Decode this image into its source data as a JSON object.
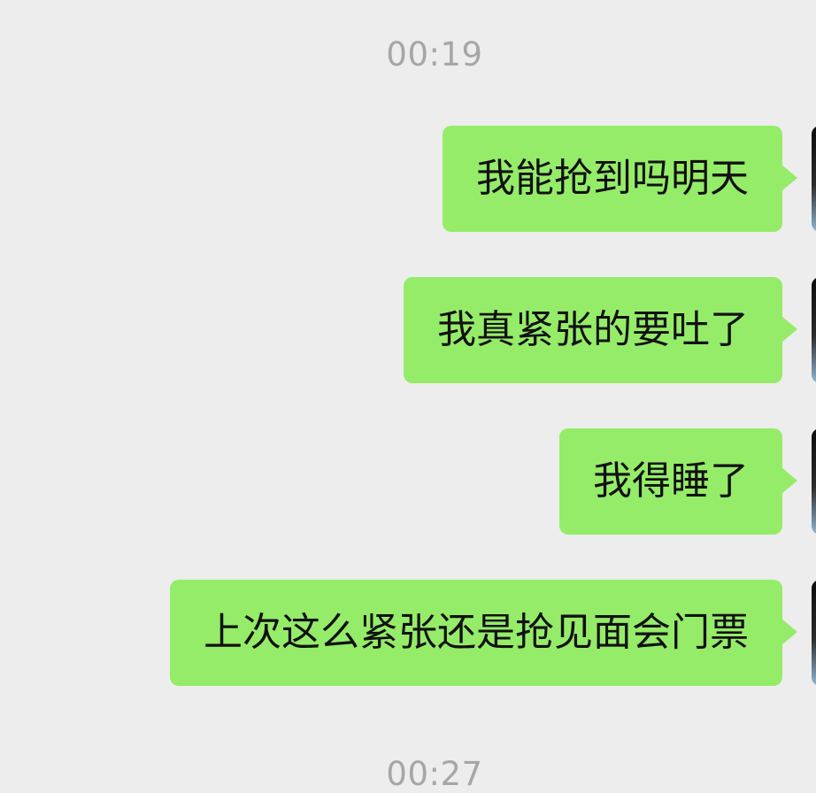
{
  "chat": {
    "timestamps": {
      "top": "00:19",
      "bottom": "00:27"
    },
    "messages": [
      {
        "text": "我能抢到吗明天"
      },
      {
        "text": "我真紧张的要吐了"
      },
      {
        "text": "我得睡了"
      },
      {
        "text": "上次这么紧张还是抢见面会门票"
      }
    ]
  },
  "colors": {
    "background": "#ededed",
    "outgoing_bubble": "#95ec69",
    "timestamp_text": "#a6a6a6",
    "message_text": "#111111"
  }
}
